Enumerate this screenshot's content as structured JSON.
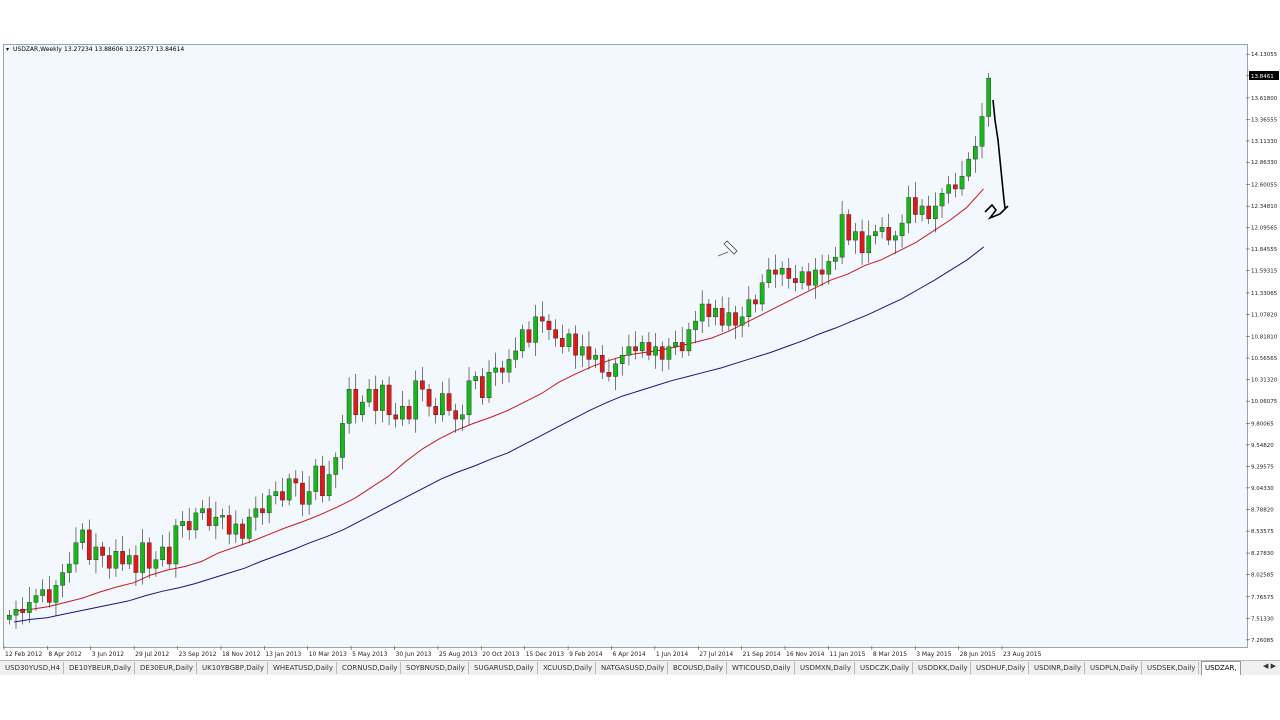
{
  "header": {
    "symbol_title": "USDZAR,Weekly",
    "ohlc": "13.27234 13.88606 13.22577 13.84614"
  },
  "current_price_tag": "13.8461",
  "colors": {
    "bull": "#18b818",
    "bear": "#e01818",
    "ema_fast": "#d01818",
    "ema_slow": "#101880",
    "chart_bg": "#f2f8fd",
    "annotation": "#000000"
  },
  "chart_data": {
    "type": "candlestick",
    "title": "USDZAR,Weekly",
    "price_axis": {
      "ticks": [
        "14.13055",
        "13.88040",
        "13.61800",
        "13.36555",
        "13.11330",
        "12.86330",
        "12.60055",
        "12.34810",
        "12.09565",
        "11.84555",
        "11.59315",
        "11.33065",
        "11.07820",
        "10.81810",
        "10.56565",
        "10.31320",
        "10.06075",
        "9.80065",
        "9.54820",
        "9.29575",
        "9.04330",
        "8.78820",
        "8.53575",
        "8.27830",
        "8.02585",
        "7.76575",
        "7.51330",
        "7.26085"
      ],
      "ylim": [
        7.2,
        14.18
      ]
    },
    "date_axis": {
      "ticks": [
        "12 Feb 2012",
        "8 Apr 2012",
        "3 Jun 2012",
        "29 Jul 2012",
        "23 Sep 2012",
        "18 Nov 2012",
        "13 Jan 2013",
        "10 Mar 2013",
        "5 May 2013",
        "30 Jun 2013",
        "25 Aug 2013",
        "20 Oct 2013",
        "15 Dec 2013",
        "9 Feb 2014",
        "6 Apr 2014",
        "1 Jun 2014",
        "27 Jul 2014",
        "21 Sep 2014",
        "16 Nov 2014",
        "11 Jan 2015",
        "8 Mar 2015",
        "3 May 2015",
        "28 Jun 2015",
        "23 Aug 2015"
      ]
    },
    "weekly_close": [
      7.55,
      7.62,
      7.58,
      7.7,
      7.78,
      7.85,
      7.7,
      7.9,
      8.05,
      8.15,
      8.4,
      8.55,
      8.2,
      8.35,
      8.25,
      8.1,
      8.3,
      8.15,
      8.25,
      8.05,
      8.4,
      8.1,
      8.2,
      8.35,
      8.15,
      8.6,
      8.65,
      8.55,
      8.75,
      8.8,
      8.6,
      8.7,
      8.72,
      8.5,
      8.62,
      8.45,
      8.7,
      8.8,
      8.75,
      8.95,
      9.0,
      8.9,
      9.15,
      9.1,
      8.85,
      9.0,
      9.3,
      8.95,
      9.2,
      9.4,
      9.8,
      10.2,
      9.9,
      10.05,
      10.2,
      9.95,
      10.25,
      9.9,
      9.85,
      10.0,
      9.85,
      10.3,
      10.2,
      10.0,
      9.9,
      10.15,
      9.95,
      9.85,
      9.9,
      10.3,
      10.35,
      10.1,
      10.4,
      10.45,
      10.4,
      10.55,
      10.65,
      10.9,
      10.75,
      11.05,
      11.0,
      10.9,
      10.8,
      10.7,
      10.85,
      10.6,
      10.7,
      10.55,
      10.6,
      10.4,
      10.35,
      10.5,
      10.6,
      10.7,
      10.65,
      10.75,
      10.6,
      10.7,
      10.55,
      10.7,
      10.75,
      10.65,
      10.9,
      11.0,
      11.2,
      11.05,
      11.15,
      10.95,
      11.1,
      10.95,
      11.05,
      11.25,
      11.2,
      11.45,
      11.6,
      11.55,
      11.62,
      11.5,
      11.45,
      11.58,
      11.42,
      11.6,
      11.55,
      11.7,
      11.75,
      12.25,
      11.95,
      12.05,
      11.8,
      12.0,
      12.05,
      12.1,
      11.95,
      12.0,
      12.15,
      12.45,
      12.25,
      12.35,
      12.2,
      12.35,
      12.5,
      12.6,
      12.55,
      12.7,
      12.9,
      13.05,
      13.4,
      13.85
    ],
    "series": [
      {
        "name": "EMA fast",
        "values": [
          7.6,
          7.62,
          7.65,
          7.7,
          7.75,
          7.82,
          7.88,
          7.93,
          8.02,
          8.08,
          8.12,
          8.18,
          8.28,
          8.35,
          8.42,
          8.5,
          8.58,
          8.65,
          8.73,
          8.82,
          8.92,
          9.05,
          9.18,
          9.35,
          9.5,
          9.62,
          9.72,
          9.8,
          9.87,
          9.95,
          10.05,
          10.15,
          10.28,
          10.38,
          10.47,
          10.54,
          10.6,
          10.63,
          10.66,
          10.7,
          10.75,
          10.8,
          10.88,
          10.98,
          11.08,
          11.18,
          11.28,
          11.38,
          11.48,
          11.55,
          11.65,
          11.72,
          11.82,
          11.92,
          12.05,
          12.18,
          12.33,
          12.55
        ]
      },
      {
        "name": "EMA slow",
        "values": [
          7.47,
          7.5,
          7.52,
          7.56,
          7.6,
          7.64,
          7.68,
          7.72,
          7.78,
          7.83,
          7.87,
          7.92,
          7.98,
          8.04,
          8.1,
          8.18,
          8.25,
          8.32,
          8.4,
          8.47,
          8.55,
          8.65,
          8.75,
          8.85,
          8.95,
          9.05,
          9.15,
          9.23,
          9.3,
          9.38,
          9.45,
          9.55,
          9.65,
          9.75,
          9.85,
          9.95,
          10.04,
          10.12,
          10.18,
          10.24,
          10.3,
          10.35,
          10.4,
          10.45,
          10.51,
          10.57,
          10.63,
          10.7,
          10.77,
          10.85,
          10.92,
          11.0,
          11.08,
          11.17,
          11.26,
          11.37,
          11.48,
          11.6,
          11.72,
          11.87
        ]
      }
    ]
  },
  "symbol_tabs": [
    "USD30YUSD,H4",
    "DE10YBEUR,Daily",
    "DE30EUR,Daily",
    "UK10YBGBP,Daily",
    "WHEATUSD,Daily",
    "CORNUSD,Daily",
    "SOYBNUSD,Daily",
    "SUGARUSD,Daily",
    "XCUUSD,Daily",
    "NATGASUSD,Daily",
    "BCOUSD,Daily",
    "WTICOUSD,Daily",
    "USDMXN,Daily",
    "USDCZK,Daily",
    "USDDKK,Daily",
    "USDHUF,Daily",
    "USDINR,Daily",
    "USDPLN,Daily",
    "USDSEK,Daily",
    "USDZAR,"
  ],
  "tab_scroll": "◀ ▶"
}
